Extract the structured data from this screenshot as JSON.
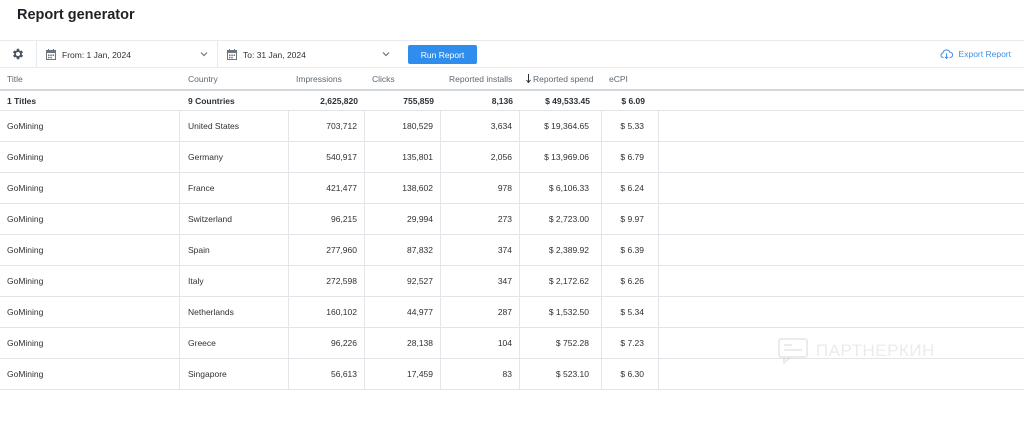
{
  "page": {
    "title": "Report generator"
  },
  "toolbar": {
    "settings_icon": "gear-icon",
    "from_date": "From: 1 Jan, 2024",
    "to_date": "To: 31 Jan, 2024",
    "run_label": "Run Report",
    "export_label": "Export Report",
    "accent_color": "#2f8ded"
  },
  "table": {
    "headers": {
      "title": "Title",
      "country": "Country",
      "impressions": "Impressions",
      "clicks": "Clicks",
      "installs": "Reported installs",
      "spend": "Reported spend",
      "ecpi": "eCPI"
    },
    "sort": {
      "column": "spend",
      "direction": "descending",
      "icon": "arrow-down-icon"
    },
    "totals": {
      "title": "1 Titles",
      "country": "9 Countries",
      "impressions": "2,625,820",
      "clicks": "755,859",
      "installs": "8,136",
      "spend": "$ 49,533.45",
      "ecpi": "$ 6.09"
    },
    "rows": [
      {
        "title": "GoMining",
        "country": "United States",
        "impressions": "703,712",
        "clicks": "180,529",
        "installs": "3,634",
        "spend": "$ 19,364.65",
        "ecpi": "$ 5.33"
      },
      {
        "title": "GoMining",
        "country": "Germany",
        "impressions": "540,917",
        "clicks": "135,801",
        "installs": "2,056",
        "spend": "$ 13,969.06",
        "ecpi": "$ 6.79"
      },
      {
        "title": "GoMining",
        "country": "France",
        "impressions": "421,477",
        "clicks": "138,602",
        "installs": "978",
        "spend": "$ 6,106.33",
        "ecpi": "$ 6.24"
      },
      {
        "title": "GoMining",
        "country": "Switzerland",
        "impressions": "96,215",
        "clicks": "29,994",
        "installs": "273",
        "spend": "$ 2,723.00",
        "ecpi": "$ 9.97"
      },
      {
        "title": "GoMining",
        "country": "Spain",
        "impressions": "277,960",
        "clicks": "87,832",
        "installs": "374",
        "spend": "$ 2,389.92",
        "ecpi": "$ 6.39"
      },
      {
        "title": "GoMining",
        "country": "Italy",
        "impressions": "272,598",
        "clicks": "92,527",
        "installs": "347",
        "spend": "$ 2,172.62",
        "ecpi": "$ 6.26"
      },
      {
        "title": "GoMining",
        "country": "Netherlands",
        "impressions": "160,102",
        "clicks": "44,977",
        "installs": "287",
        "spend": "$ 1,532.50",
        "ecpi": "$ 5.34"
      },
      {
        "title": "GoMining",
        "country": "Greece",
        "impressions": "96,226",
        "clicks": "28,138",
        "installs": "104",
        "spend": "$ 752.28",
        "ecpi": "$ 7.23"
      },
      {
        "title": "GoMining",
        "country": "Singapore",
        "impressions": "56,613",
        "clicks": "17,459",
        "installs": "83",
        "spend": "$ 523.10",
        "ecpi": "$ 6.30"
      }
    ]
  },
  "watermark": {
    "text": "ПАРТНЕРКИН"
  }
}
